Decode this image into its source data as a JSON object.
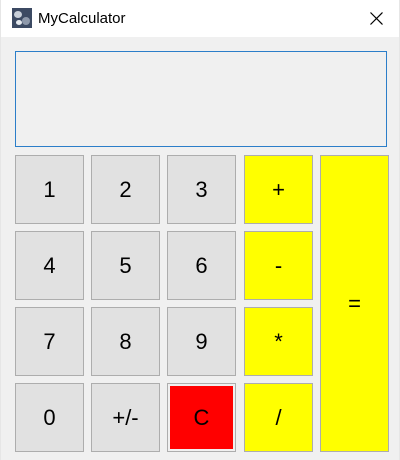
{
  "window": {
    "title": "MyCalculator",
    "app_icon": "calculator-app-icon",
    "close_icon": "close-icon"
  },
  "display": {
    "value": ""
  },
  "keypad": {
    "digits": {
      "one": "1",
      "two": "2",
      "three": "3",
      "four": "4",
      "five": "5",
      "six": "6",
      "seven": "7",
      "eight": "8",
      "nine": "9",
      "zero": "0"
    },
    "negate": "+/-",
    "clear": "C",
    "operators": {
      "add": "+",
      "subtract": "-",
      "multiply": "*",
      "divide": "/",
      "equals": "="
    }
  },
  "colors": {
    "operator_key": "#ffff00",
    "clear_key": "#ff0000",
    "digit_key": "#e1e1e1",
    "display_border": "#2b7ec9"
  }
}
